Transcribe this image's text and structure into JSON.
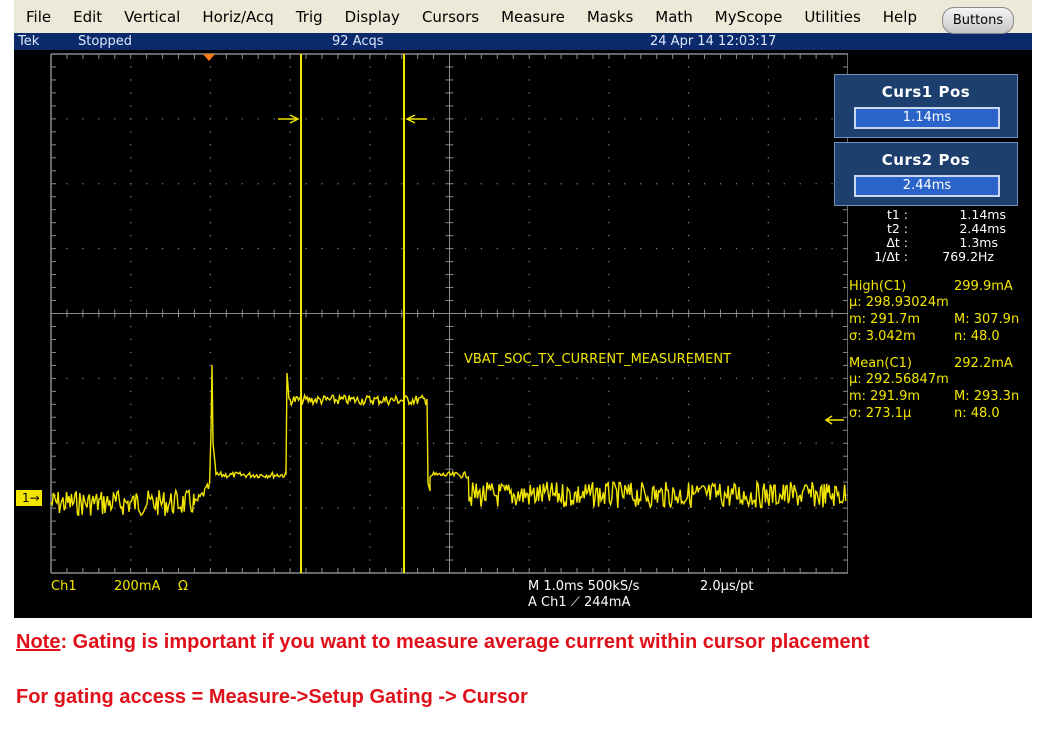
{
  "menu": [
    "File",
    "Edit",
    "Vertical",
    "Horiz/Acq",
    "Trig",
    "Display",
    "Cursors",
    "Measure",
    "Masks",
    "Math",
    "MyScope",
    "Utilities",
    "Help"
  ],
  "status": {
    "brand": "Tek",
    "state": "Stopped",
    "acqs": "92 Acqs",
    "datetime": "24 Apr 14 12:03:17"
  },
  "buttons_label": "Buttons",
  "curs1": {
    "title": "Curs1 Pos",
    "value": "1.14ms"
  },
  "curs2": {
    "title": "Curs2 Pos",
    "value": "2.44ms"
  },
  "cursor_readout": [
    {
      "label": "t1 :",
      "value": "1.14ms"
    },
    {
      "label": "t2 :",
      "value": "2.44ms"
    },
    {
      "label": "Δt :",
      "value": "1.3ms"
    },
    {
      "label": "1/Δt :",
      "value": "769.2Hz"
    }
  ],
  "meas_high": {
    "title": "High(C1)",
    "value": "299.9mA",
    "mu": "µ: 298.93024m",
    "min": "m: 291.7m",
    "max": "M: 307.9n",
    "sigma": "σ: 3.042m",
    "n": "n: 48.0"
  },
  "meas_mean": {
    "title": "Mean(C1)",
    "value": "292.2mA",
    "mu": "µ: 292.56847m",
    "min": "m: 291.9m",
    "max": "M: 293.3n",
    "sigma": "σ: 273.1µ",
    "n": "n: 48.0"
  },
  "waveform_label": "VBAT_SOC_TX_CURRENT_MEASUREMENT",
  "channel_marker": "1",
  "bottom": {
    "ch": "Ch1",
    "scale": "200mA",
    "ohm": "Ω",
    "timebase": "M 1.0ms 500kS/s",
    "resolution": "2.0µs/pt",
    "trigger": "A  Ch1  ⟋  244mA"
  },
  "note": {
    "prefix": "Note",
    "text": ": Gating is important if you want to measure average current within cursor placement"
  },
  "gating": "For gating access = Measure->Setup Gating -> Cursor",
  "colors": {
    "trace": "#f2e600",
    "cursor": "#f2e600",
    "grid": "#8a8a8a",
    "note": "#e0101a"
  }
}
